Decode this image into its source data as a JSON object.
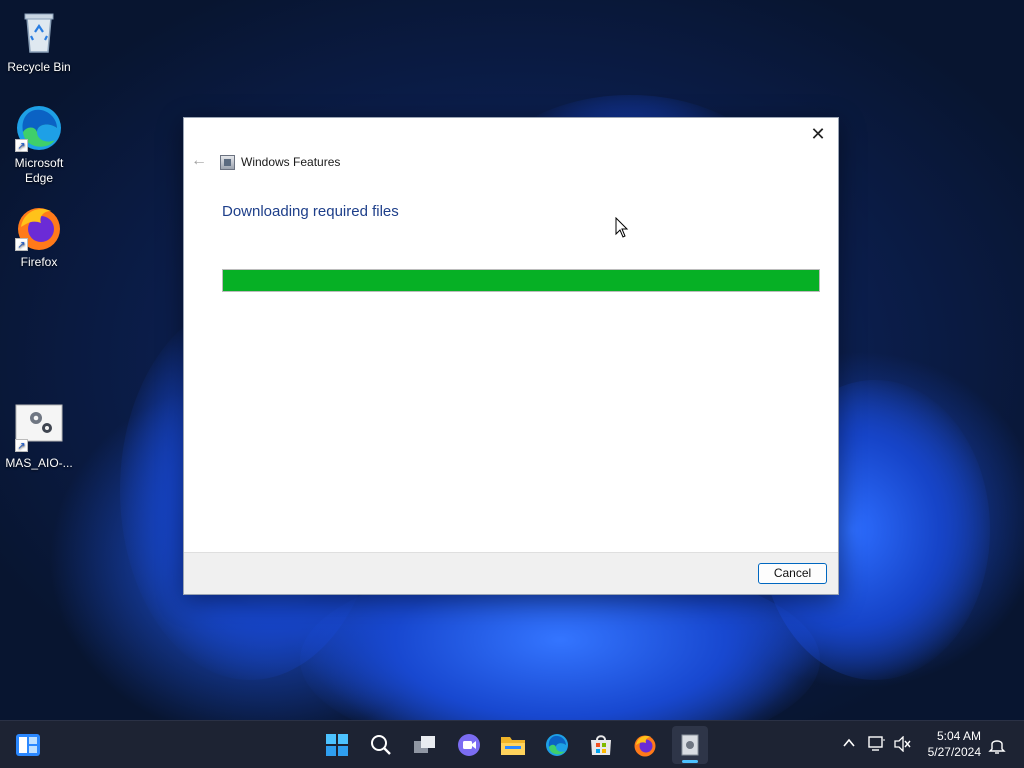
{
  "desktop": {
    "icons": [
      {
        "label": "Recycle Bin",
        "icon": "recycle-bin-icon"
      },
      {
        "label": "Microsoft Edge",
        "icon": "edge-icon"
      },
      {
        "label": "Firefox",
        "icon": "firefox-icon"
      },
      {
        "label": "MAS_AIO-...",
        "icon": "settings-gear-icon"
      }
    ]
  },
  "dialog": {
    "close_glyph": "✕",
    "back_glyph": "←",
    "window_title": "Windows Features",
    "heading": "Downloading required files",
    "progress_percent": 100,
    "progress_color": "#06b025",
    "cancel_label": "Cancel"
  },
  "taskbar": {
    "pinned": [
      "start-icon",
      "search-icon",
      "task-view-icon",
      "chat-icon",
      "file-explorer-icon",
      "edge-icon",
      "store-icon",
      "firefox-icon",
      "windows-features-icon"
    ],
    "tray": {
      "time": "5:04 AM",
      "date": "5/27/2024"
    }
  }
}
